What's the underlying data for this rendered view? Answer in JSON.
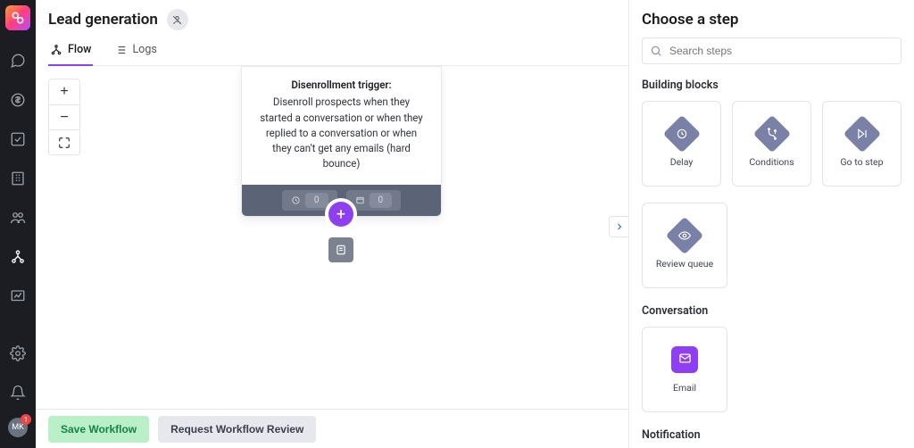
{
  "rail": {
    "avatar_initials": "MK",
    "badge_count": "1"
  },
  "header": {
    "title": "Lead generation"
  },
  "tabs": {
    "flow": "Flow",
    "logs": "Logs"
  },
  "trigger": {
    "title": "Disenrollment trigger:",
    "body": "Disenroll prospects when they started a conversation or when they replied to a conversation or when they can't get any emails (hard bounce)",
    "badge1": "0",
    "badge2": "0"
  },
  "footer": {
    "save": "Save Workflow",
    "review": "Request Workflow Review"
  },
  "panel": {
    "title": "Choose a step",
    "search_placeholder": "Search steps",
    "sections": {
      "building": "Building blocks",
      "conversation": "Conversation",
      "notification": "Notification"
    },
    "tiles": {
      "delay": "Delay",
      "conditions": "Conditions",
      "goto": "Go to step",
      "review": "Review queue",
      "email": "Email"
    }
  }
}
